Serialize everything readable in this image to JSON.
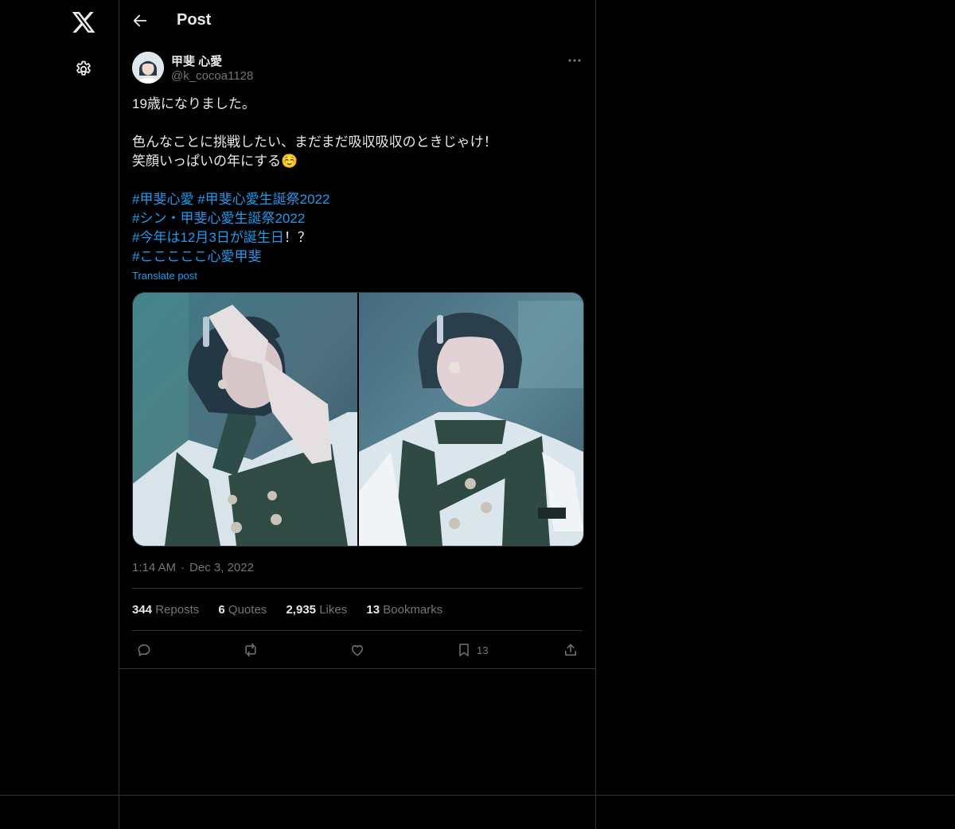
{
  "nav": {
    "logo_icon": "x-logo-icon",
    "settings_icon": "gear-icon"
  },
  "header": {
    "title": "Post",
    "back_icon": "arrow-left-icon"
  },
  "post": {
    "author": {
      "name": "甲斐 心愛",
      "handle": "@k_cocoa1128"
    },
    "text_line1": "19歳になりました。",
    "text_line2": "色んなことに挑戦したい、まだまだ吸収吸収のときじゃけ！",
    "text_line3": "笑顔いっぱいの年にする",
    "emoji": "☺️",
    "hashtags": {
      "h1": "#甲斐心愛",
      "h2": "#甲斐心愛生誕祭2022",
      "h3": "#シン・甲斐心愛生誕祭2022",
      "h4": "#今年は12月3日が誕生日",
      "h4_suffix": "！？",
      "h5": "#こここここ心愛甲斐"
    },
    "translate_label": "Translate post",
    "time": "1:14 AM",
    "separator": "·",
    "date": "Dec 3, 2022",
    "stats": {
      "reposts_count": "344",
      "reposts_label": "Reposts",
      "quotes_count": "6",
      "quotes_label": "Quotes",
      "likes_count": "2,935",
      "likes_label": "Likes",
      "bookmarks_count": "13",
      "bookmarks_label": "Bookmarks"
    },
    "actions": {
      "bookmark_count": "13"
    }
  },
  "colors": {
    "background": "#000000",
    "link": "#1d9bf0",
    "muted": "#71767b",
    "border": "#2f3336",
    "text": "#e7e9ea"
  }
}
